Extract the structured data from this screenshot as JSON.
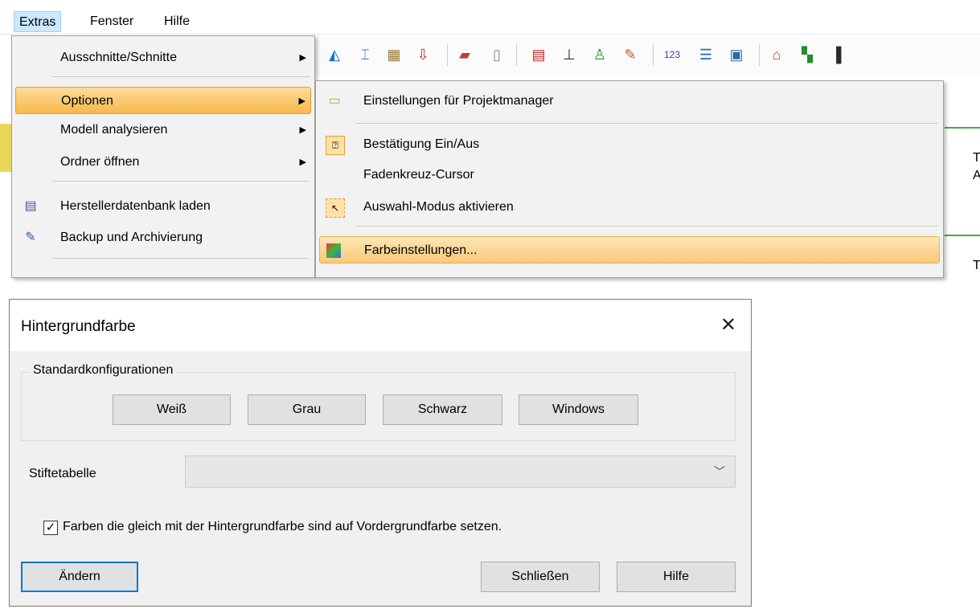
{
  "menubar": {
    "items": [
      "Extras",
      "Fenster",
      "Hilfe"
    ]
  },
  "extras_menu": {
    "items": [
      {
        "label": "Ausschnitte/Schnitte",
        "submenu": true,
        "highlighted": false
      },
      {
        "label": "Optionen",
        "submenu": true,
        "highlighted": true
      },
      {
        "label": "Modell analysieren",
        "submenu": true,
        "highlighted": false
      },
      {
        "label": "Ordner öffnen",
        "submenu": true,
        "highlighted": false
      },
      {
        "label": "Herstellerdatenbank laden",
        "submenu": false,
        "icon": "database-icon"
      },
      {
        "label": "Backup und Archivierung",
        "submenu": false,
        "icon": "backup-icon"
      }
    ]
  },
  "options_submenu": {
    "items": [
      {
        "label": "Einstellungen für Projektmanager",
        "icon": "folder-settings-icon"
      },
      {
        "label": "Bestätigung Ein/Aus",
        "icon": "confirmation-icon"
      },
      {
        "label": "Fadenkreuz-Cursor",
        "icon": ""
      },
      {
        "label": "Auswahl-Modus aktivieren",
        "icon": "selection-mode-icon"
      },
      {
        "label": "Farbeinstellungen...",
        "icon": "color-settings-icon",
        "highlighted": true
      }
    ]
  },
  "background_text": {
    "t1": "T",
    "a1": "A",
    "t2": "T"
  },
  "dialog": {
    "title": "Hintergrundfarbe",
    "group_label": "Standardkonfigurationen",
    "presets": [
      "Weiß",
      "Grau",
      "Schwarz",
      "Windows"
    ],
    "pen_table_label": "Stiftetabelle",
    "pen_table_value": "",
    "checkbox_label": "Farben die gleich mit der Hintergrundfarbe sind auf Vordergrundfarbe setzen.",
    "checkbox_checked": true,
    "change_button": "Ändern",
    "close_button": "Schließen",
    "help_button": "Hilfe"
  },
  "colors": {
    "menu_highlight": "#f7b84a",
    "menubar_active": "#cce8ff",
    "focus_border": "#0078d7"
  }
}
